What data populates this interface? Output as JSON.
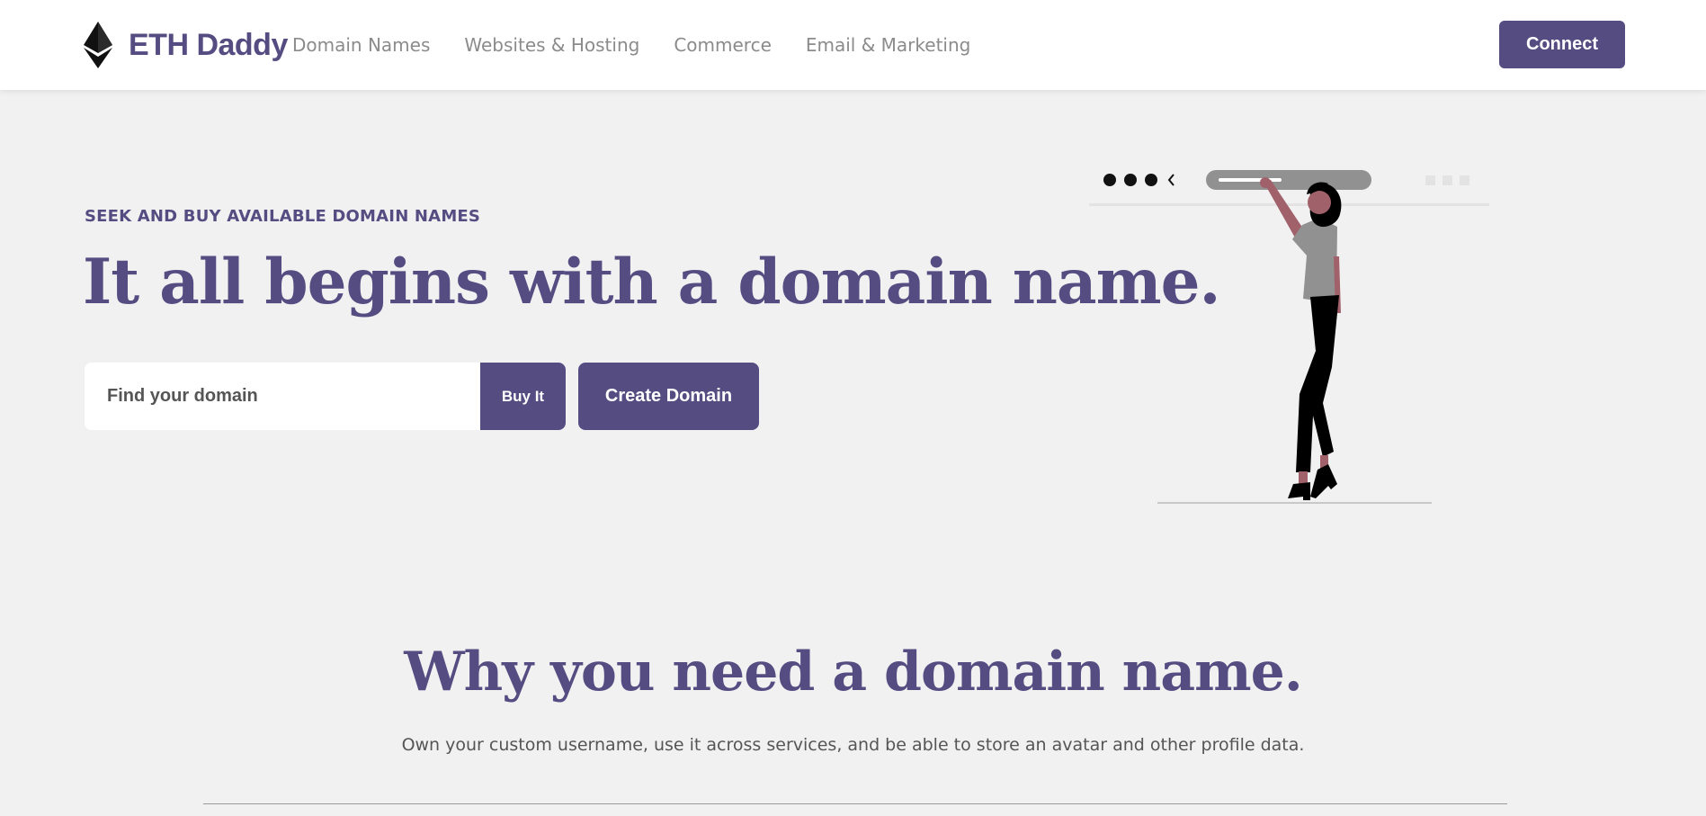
{
  "nav": {
    "brand": "ETH Daddy",
    "links": [
      "Domain Names",
      "Websites & Hosting",
      "Commerce",
      "Email & Marketing"
    ],
    "connect_label": "Connect"
  },
  "hero": {
    "eyebrow": "SEEK AND BUY AVAILABLE DOMAIN NAMES",
    "title": "It all begins with a domain name.",
    "search_placeholder": "Find your domain",
    "buy_label": "Buy It",
    "create_label": "Create Domain"
  },
  "why": {
    "title": "Why you need a domain name.",
    "subtitle": "Own your custom username, use it across services, and be able to store an avatar and other profile data."
  },
  "colors": {
    "brand": "#554d82",
    "background": "#f1f1f1",
    "nav_text": "#8b8b8b"
  },
  "icons": {
    "logo": "ethereum-diamond-icon",
    "illustration": "person-at-browser-illustration"
  }
}
